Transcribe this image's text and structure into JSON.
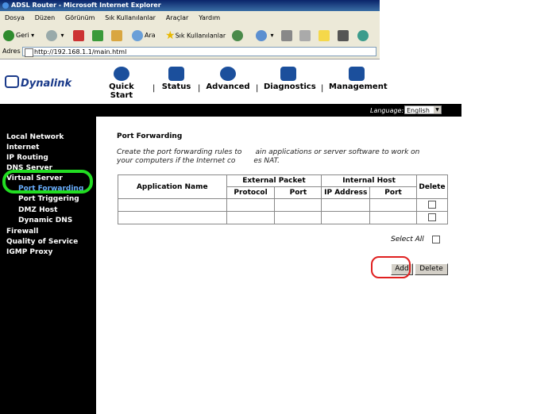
{
  "window": {
    "title": "ADSL Router - Microsoft Internet Explorer"
  },
  "menu": [
    "Dosya",
    "Düzen",
    "Görünüm",
    "Sık Kullanılanlar",
    "Araçlar",
    "Yardım"
  ],
  "toolbar": {
    "back": "Geri",
    "search": "Ara",
    "favorites": "Sık Kullanılanlar"
  },
  "address": {
    "label": "Adres",
    "url": "http://192.168.1.1/main.html"
  },
  "router": {
    "logo": "Dynalink",
    "nav": [
      "Quick Start",
      "Status",
      "Advanced",
      "Diagnostics",
      "Management"
    ],
    "separator": "|",
    "language_label": "Language:",
    "language_value": "English"
  },
  "sidebar": {
    "items": [
      "Local Network",
      "Internet",
      "IP Routing",
      "DNS Server",
      "Virtual Server",
      "Port Forwarding",
      "Port Triggering",
      "DMZ Host",
      "Dynamic DNS",
      "Firewall",
      "Quality of Service",
      "IGMP Proxy"
    ]
  },
  "page": {
    "title": "Port Forwarding",
    "desc_line1": "Create the port forwarding rules to",
    "desc_line1b": "ain applications or server software to work on",
    "desc_line2": "your computers if the Internet co",
    "desc_line2b": "es NAT.",
    "table": {
      "app_name": "Application Name",
      "external_packet": "External Packet",
      "internal_host": "Internal Host",
      "delete": "Delete",
      "protocol": "Protocol",
      "port": "Port",
      "ip_address": "IP Address",
      "port2": "Port"
    },
    "select_all": "Select All",
    "add_button": "Add",
    "delete_button": "Delete"
  },
  "colors": {
    "sidebar_bg": "#000000",
    "active_link": "#6ab0ff",
    "annotation_green": "#22dd22",
    "annotation_red": "#e02020"
  }
}
